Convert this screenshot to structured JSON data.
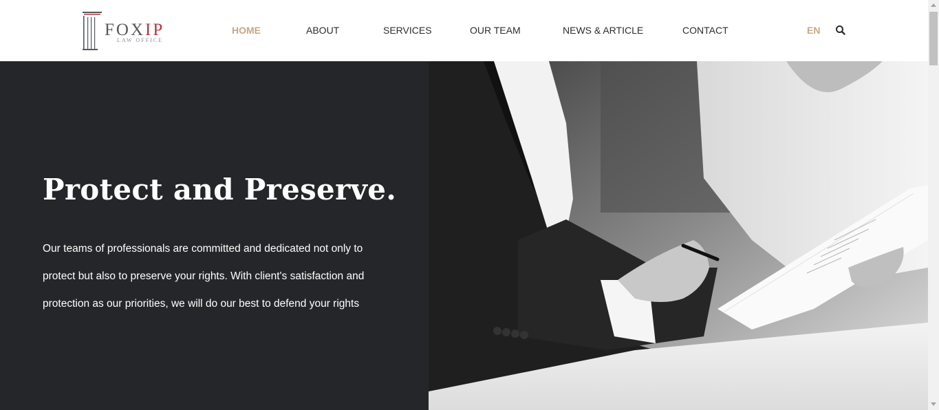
{
  "brand": {
    "name_part1": "FOX",
    "name_part2": "IP",
    "tagline": "LAW OFFICE"
  },
  "nav": {
    "items": [
      {
        "label": "HOME",
        "active": true
      },
      {
        "label": "ABOUT",
        "active": false
      },
      {
        "label": "SERVICES",
        "active": false
      },
      {
        "label": "OUR TEAM",
        "active": false
      },
      {
        "label": "NEWS & ARTICLE",
        "active": false
      },
      {
        "label": "CONTACT",
        "active": false
      }
    ],
    "language": "EN"
  },
  "hero": {
    "title": "Protect and Preserve.",
    "body": "Our teams of professionals are committed and dedicated not only to protect but also to preserve your rights. With client's satisfaction and protection as our priorities, we will do our best to defend your rights"
  },
  "colors": {
    "accent": "#c5a884",
    "logo_red": "#b3343f",
    "dark_panel": "#252629"
  }
}
